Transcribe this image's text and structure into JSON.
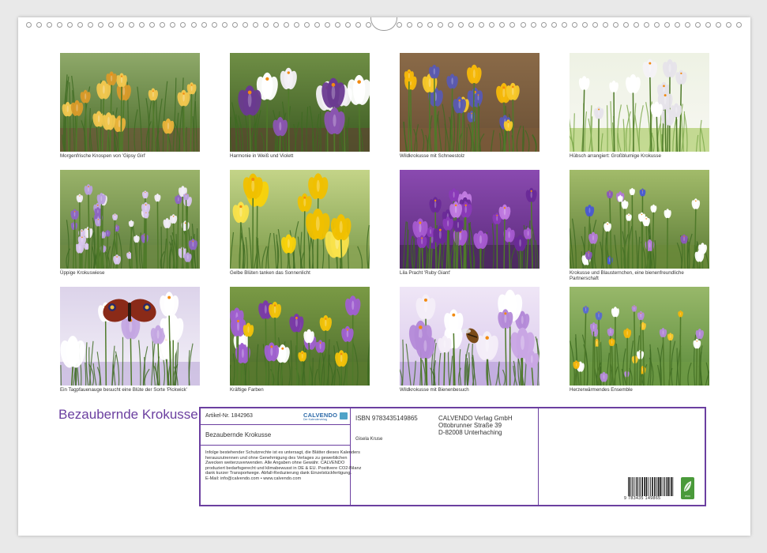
{
  "calendar": {
    "title": "Bezaubernde Krokusse",
    "photos": [
      {
        "caption": "Morgenfrische Knospen von 'Gipsy Girl'",
        "scene": "yellow-buds"
      },
      {
        "caption": "Harmonie in Weiß und Violett",
        "scene": "white-violet"
      },
      {
        "caption": "Wildkrokusse mit Schneestolz",
        "scene": "yellow-wild"
      },
      {
        "caption": "Hübsch arrangiert: Großblumige Krokusse",
        "scene": "white-arranged"
      },
      {
        "caption": "Üppige Krokuswiese",
        "scene": "purple-meadow"
      },
      {
        "caption": "Gelbe Blüten tanken das Sonnenlicht",
        "scene": "yellow-sun"
      },
      {
        "caption": "Lila Pracht 'Ruby Giant'",
        "scene": "ruby-giant"
      },
      {
        "caption": "Krokusse und Blausternchen, eine bienenfreundliche Partnerschaft",
        "scene": "purple-scilla"
      },
      {
        "caption": "Ein Tagpfauenauge besucht eine Blüte der Sorte 'Pickwick'",
        "scene": "butterfly"
      },
      {
        "caption": "Kräftige Farben",
        "scene": "mixed-strong"
      },
      {
        "caption": "Wildkrokusse mit Bienenbesuch",
        "scene": "bee"
      },
      {
        "caption": "Herzerwärmendes Ensemble",
        "scene": "ensemble"
      }
    ]
  },
  "imprint": {
    "article_label": "Artikel-Nr. 1842963",
    "logo_text": "CALVENDO",
    "logo_sub": "Der Kalenderverlag",
    "product_title": "Bezaubernde Krokusse",
    "isbn": "ISBN 9783435149865",
    "author": "Gisela Kruse",
    "publisher_lines": [
      "CALVENDO Verlag GmbH",
      "Ottobrunner Straße 39",
      "D-82008 Unterhaching"
    ],
    "legal_text": "Infolge bestehender Schutzrechte ist es untersagt, die Blätter dieses Kalenders herauszutrennen und ohne Genehmigung des Verlages zu gewerblichen Zwecken weiterzuverwenden. Alle Angaben ohne Gewähr. CALVENDO produziert bedarfsgerecht und klimabewusst in DE & EU. Positivere CO2-Bilanz dank kurzer Transportwege. Abfall-Reduzierung dank Einzelstückfertigung.",
    "contact": "E-Mail: info@calvendo.com • www.calvendo.com",
    "barcode_number": "9 783435 149865",
    "eco_label": "eco"
  },
  "colors": {
    "accent": "#6b3fa0",
    "logo_blue": "#2d6aa8",
    "eco_green": "#4a9a3a"
  }
}
